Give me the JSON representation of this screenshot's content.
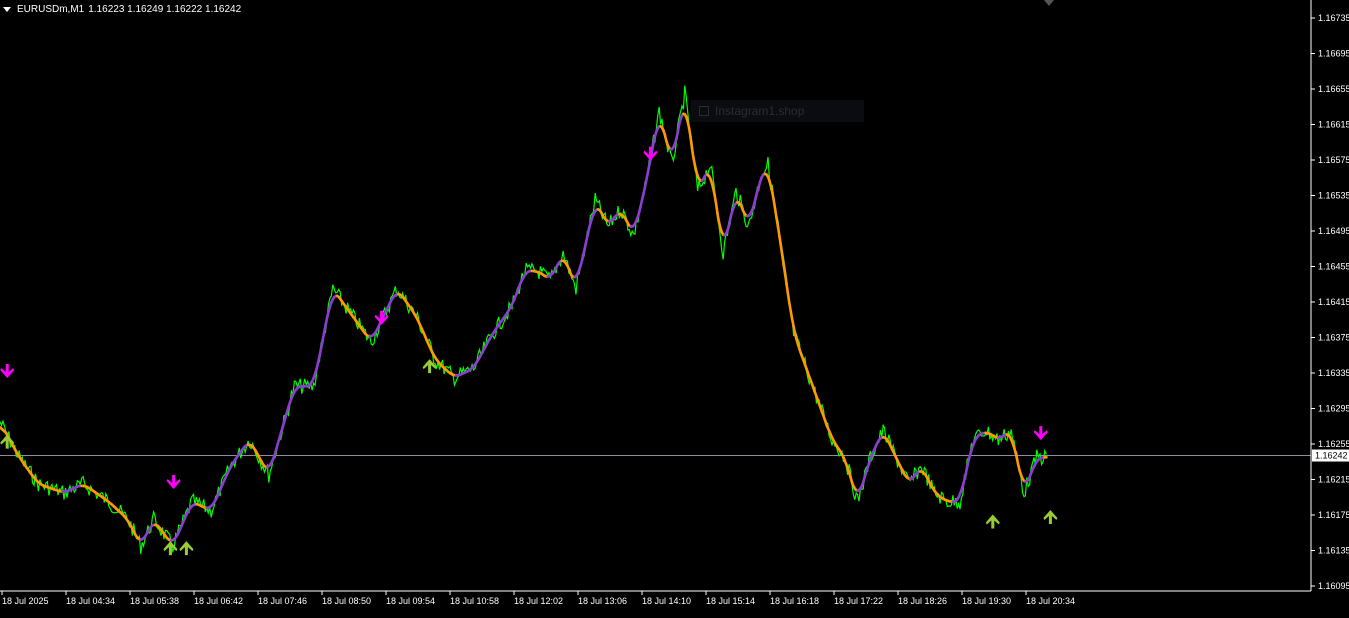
{
  "window": {
    "symbol_label": "EURUSDm,M1",
    "ohlc_label": "1.16223 1.16249 1.16222 1.16242",
    "watermark_text": "Instagram1.shop"
  },
  "colors": {
    "background": "#000000",
    "price": "#00ff00",
    "ma_up": "#8a3fd1",
    "ma_down": "#ff9900",
    "arrow_sell": "#ff00ff",
    "arrow_buy": "#99cc33",
    "axis": "#ffffff",
    "bid_line": "#8a8fa0"
  },
  "chart_data": {
    "type": "line",
    "x_labels": [
      "18 Jul 2025",
      "18 Jul 04:34",
      "18 Jul 05:38",
      "18 Jul 06:42",
      "18 Jul 07:46",
      "18 Jul 08:50",
      "18 Jul 09:54",
      "18 Jul 10:58",
      "18 Jul 12:02",
      "18 Jul 13:06",
      "18 Jul 14:10",
      "18 Jul 15:14",
      "18 Jul 16:18",
      "18 Jul 17:22",
      "18 Jul 18:26",
      "18 Jul 19:30",
      "18 Jul 20:34"
    ],
    "y_ticks": [
      "1.16735",
      "1.16695",
      "1.16655",
      "1.16615",
      "1.16575",
      "1.16535",
      "1.16495",
      "1.16455",
      "1.16415",
      "1.16375",
      "1.16335",
      "1.16295",
      "1.16255",
      "1.16215",
      "1.16175",
      "1.16135",
      "1.16095"
    ],
    "ylim": [
      1.16095,
      1.16735
    ],
    "current_price": 1.16242,
    "current_price_label": "1.16242",
    "series": [
      {
        "role": "price",
        "x": [
          0,
          0.3,
          0.6,
          1.0,
          1.3,
          1.7,
          2.0,
          2.2,
          2.4,
          2.7,
          3.0,
          3.3,
          3.6,
          3.9,
          4.2,
          4.6,
          4.9,
          5.2,
          5.5,
          5.8,
          6.2,
          6.5,
          6.8,
          7.1,
          7.4,
          7.7,
          8.0,
          8.2,
          8.4,
          8.6,
          8.8,
          9.0,
          9.15,
          9.3,
          9.5,
          9.7,
          9.9,
          10.1,
          10.3,
          10.5,
          10.7,
          10.9,
          11.1,
          11.3,
          11.5,
          11.7,
          11.9,
          12.0,
          12.2,
          12.4,
          12.6,
          12.8,
          13.0,
          13.2,
          13.4,
          13.6,
          13.8,
          14.0,
          14.2,
          14.4,
          14.6,
          14.8,
          15.0,
          15.2,
          15.4,
          15.6,
          15.8,
          16.0,
          16.2,
          16.35
        ],
        "y": [
          1.1628,
          1.1624,
          1.1621,
          1.162,
          1.1621,
          1.1619,
          1.1617,
          1.1614,
          1.1617,
          1.1614,
          1.1619,
          1.1618,
          1.1623,
          1.1626,
          1.1622,
          1.1632,
          1.1632,
          1.1643,
          1.164,
          1.1637,
          1.1643,
          1.164,
          1.1635,
          1.1633,
          1.1634,
          1.1638,
          1.1641,
          1.1645,
          1.1645,
          1.1644,
          1.1647,
          1.1643,
          1.1648,
          1.1653,
          1.165,
          1.1652,
          1.1649,
          1.1655,
          1.1663,
          1.1657,
          1.1665,
          1.1654,
          1.1657,
          1.1647,
          1.1654,
          1.165,
          1.1656,
          1.1657,
          1.1648,
          1.1638,
          1.1634,
          1.163,
          1.1626,
          1.1624,
          1.1619,
          1.1624,
          1.1627,
          1.1624,
          1.1621,
          1.1623,
          1.162,
          1.1619,
          1.1619,
          1.1626,
          1.1627,
          1.1626,
          1.1627,
          1.162,
          1.1624,
          1.1624
        ]
      }
    ],
    "signals": [
      {
        "type": "sell",
        "x": 0.05,
        "y": 1.16335
      },
      {
        "type": "buy",
        "x": 0.05,
        "y": 1.1626
      },
      {
        "type": "sell",
        "x": 2.65,
        "y": 1.1621
      },
      {
        "type": "buy",
        "x": 2.6,
        "y": 1.1614
      },
      {
        "type": "buy",
        "x": 2.85,
        "y": 1.1614
      },
      {
        "type": "sell",
        "x": 5.9,
        "y": 1.16395
      },
      {
        "type": "buy",
        "x": 6.65,
        "y": 1.16345
      },
      {
        "type": "sell",
        "x": 10.1,
        "y": 1.1658
      },
      {
        "type": "buy",
        "x": 15.45,
        "y": 1.1617
      },
      {
        "type": "sell",
        "x": 16.2,
        "y": 1.16265
      },
      {
        "type": "buy",
        "x": 16.35,
        "y": 1.16175
      }
    ]
  }
}
